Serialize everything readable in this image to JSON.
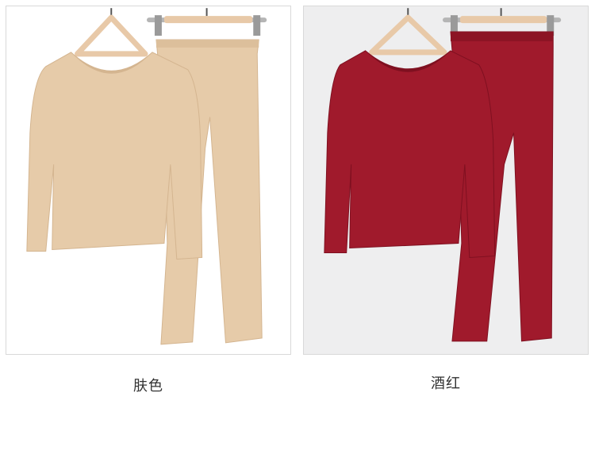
{
  "products": [
    {
      "color_name": "肤色",
      "garment_color": "#e6cba9",
      "garment_shade": "#d4b590",
      "hanger_color": "#e8c9a8",
      "background": "#ffffff"
    },
    {
      "color_name": "酒红",
      "garment_color": "#a01a2c",
      "garment_shade": "#7f1020",
      "hanger_color": "#e8c9a8",
      "background": "#eeeeef"
    }
  ]
}
